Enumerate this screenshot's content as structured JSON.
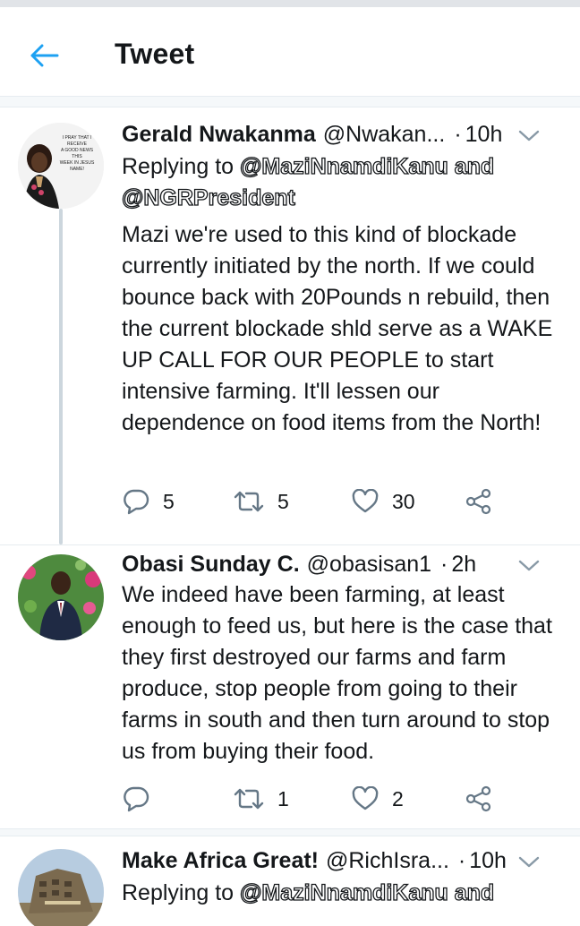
{
  "header": {
    "title": "Tweet",
    "back_icon": "arrow-left-icon"
  },
  "colors": {
    "accent": "#1da1f2",
    "text": "#14171a",
    "muted": "#657786",
    "divider": "#e6ecf0"
  },
  "tweets": [
    {
      "name": "Gerald Nwakanma",
      "handle": "@Nwakan...",
      "dot": "·",
      "time": "10h",
      "avatar_text": [
        "I PRAY THAT I",
        "RECEIVE",
        "A GOOD NEWS",
        "THIS",
        "WEEK IN JESUS",
        "NAME!"
      ],
      "replying_label": "Replying to",
      "mentions": [
        "@MaziNnamdiKanu",
        "@NGRPresident"
      ],
      "and_label": "and",
      "text": "Mazi we're used to this kind of blockade currently initiated by the north. If we could bounce back with 20Pounds n rebuild, then the current blockade shld serve as a WAKE UP CALL FOR OUR PEOPLE to start intensive farming. It'll lessen our dependence on food items from the North!",
      "replies": "5",
      "retweets": "5",
      "likes": "30"
    },
    {
      "name": "Obasi Sunday C.",
      "handle": "@obasisan1",
      "dot": "·",
      "time": "2h",
      "text": "We indeed have been farming, at least enough to feed us, but here is the case that they first destroyed our farms and farm produce, stop people from going to their farms in south and then turn around to stop us from buying their food.",
      "replies": "",
      "retweets": "1",
      "likes": "2"
    },
    {
      "name": "Make Africa Great!",
      "handle": "@RichIsra...",
      "dot": "·",
      "time": "10h",
      "replying_label": "Replying to",
      "mentions": [
        "@MaziNnamdiKanu"
      ],
      "and_label": "and"
    }
  ]
}
